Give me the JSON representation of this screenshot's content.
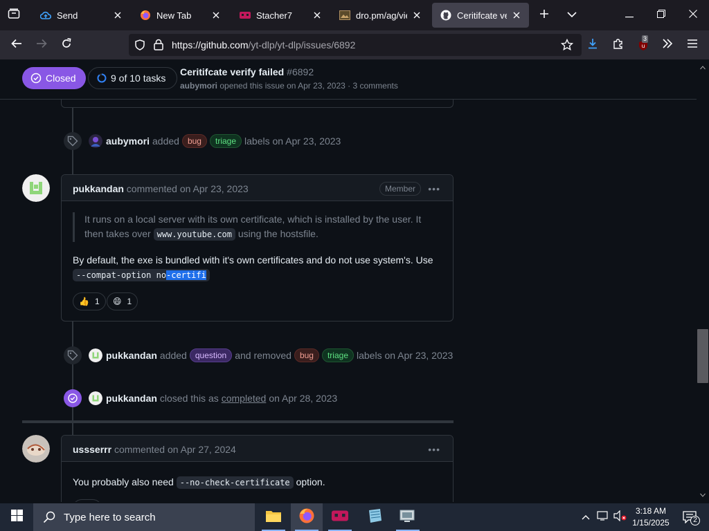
{
  "browser": {
    "tabs": [
      {
        "label": "Send",
        "icon": "cloud-upload-icon",
        "active": false
      },
      {
        "label": "New Tab",
        "icon": "firefox-icon",
        "active": false
      },
      {
        "label": "Stacher7",
        "icon": "stacher-icon",
        "active": false
      },
      {
        "label": "dro.pm/ag/view",
        "icon": "image-icon",
        "active": false
      },
      {
        "label": "Ceritifcate verify",
        "icon": "github-icon",
        "active": true
      }
    ],
    "url_host": "https://github.com",
    "url_path": "/yt-dlp/yt-dlp/issues/6892",
    "ublock_count": "3"
  },
  "issue": {
    "state_label": "Closed",
    "tasks_label": "9 of 10 tasks",
    "title": "Ceritifcate verify failed",
    "number": "#6892",
    "author": "aubymori",
    "subtitle": "opened this issue on Apr 23, 2023 · 3 comments"
  },
  "timeline": {
    "event1": {
      "user": "aubymori",
      "verb": "added",
      "labels": [
        "bug",
        "triage"
      ],
      "tail": "labels on Apr 23, 2023"
    },
    "comment1": {
      "user": "pukkandan",
      "meta": "commented on Apr 23, 2023",
      "badge": "Member",
      "quote_pre": "It runs on a local server with its own certificate, which is installed by the user. It then takes over",
      "quote_code": "www.youtube.com",
      "quote_post": "using the hostsfile.",
      "body_text": "By default, the exe is bundled with it's own certificates and do not use system's. Use",
      "body_code_plain": "--compat-option no",
      "body_code_selected": "-certifi",
      "reactions": [
        {
          "emoji": "👍",
          "count": "1"
        },
        {
          "emoji": "😄",
          "count": "1"
        }
      ]
    },
    "event2": {
      "user": "pukkandan",
      "verb": "added",
      "added_label": "question",
      "middle": "and removed",
      "removed_labels": [
        "bug",
        "triage"
      ],
      "tail": "labels on Apr 23, 2023"
    },
    "event3": {
      "user": "pukkandan",
      "verb": "closed this as",
      "link": "completed",
      "tail": "on Apr 28, 2023"
    },
    "comment2": {
      "user": "ussserrr",
      "meta": "commented on Apr 27, 2024",
      "body_pre": "You probably also need",
      "body_code": "--no-check-certificate",
      "body_post": "option."
    }
  },
  "taskbar": {
    "search_placeholder": "Type here to search",
    "time": "3:18 AM",
    "date": "1/15/2025",
    "notification_count": "2"
  },
  "colors": {
    "closed_purple": "#8957e5",
    "bg": "#0d1117",
    "border": "#30363d"
  }
}
